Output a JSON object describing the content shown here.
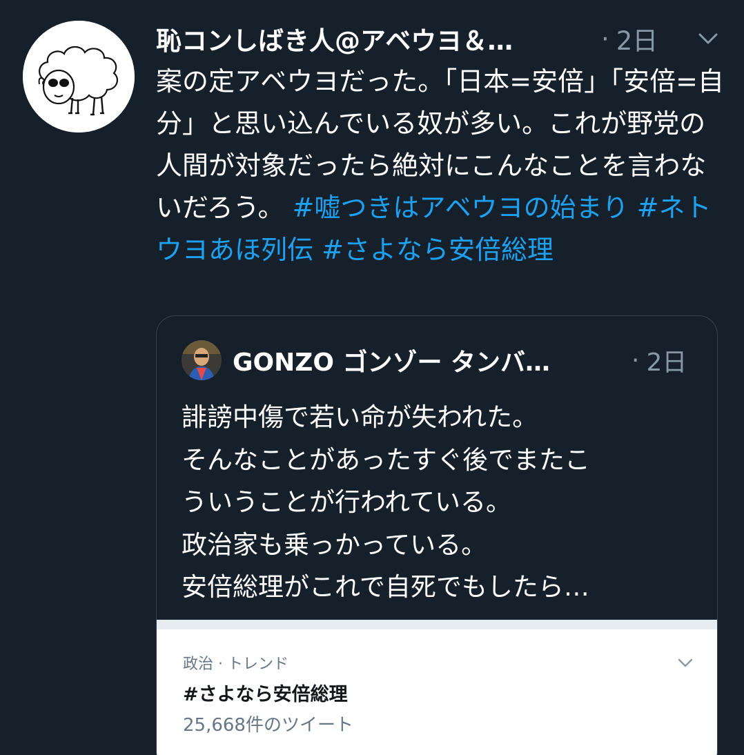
{
  "tweet": {
    "author_name": "恥コンしばき人@アベウヨ＆…",
    "time": "2日",
    "dot": "·",
    "avatar_icon": "sheep-drawing-icon",
    "body_plain": "案の定アベウヨだった。「日本=安倍」「安倍=自分」と思い込んでいる奴が多い。これが野党の人間が対象だったら絶対にこんなことを言わないだろう。",
    "hashtags": [
      "#嘘つきはアベウヨの始まり",
      "#ネトウヨあほ列伝",
      "#さよなら安倍総理"
    ],
    "text_color": "#ffffff",
    "hashtag_color": "#1da1f2",
    "background": "#15202b"
  },
  "quoted": {
    "author_name": "GONZO ゴンゾー タンバ…",
    "time": "2日",
    "dot": "·",
    "avatar_icon": "profile-photo-icon",
    "lines": [
      "誹謗中傷で若い命が失われた。",
      "そんなことがあったすぐ後でまたこ",
      "ういうことが行われている。",
      "政治家も乗っかっている。",
      "安倍総理がこれで自死でもしたら…"
    ]
  },
  "trend": {
    "category": "政治 · トレンド",
    "name": "#さよなら安倍総理",
    "count": "25,668件のツイート"
  }
}
